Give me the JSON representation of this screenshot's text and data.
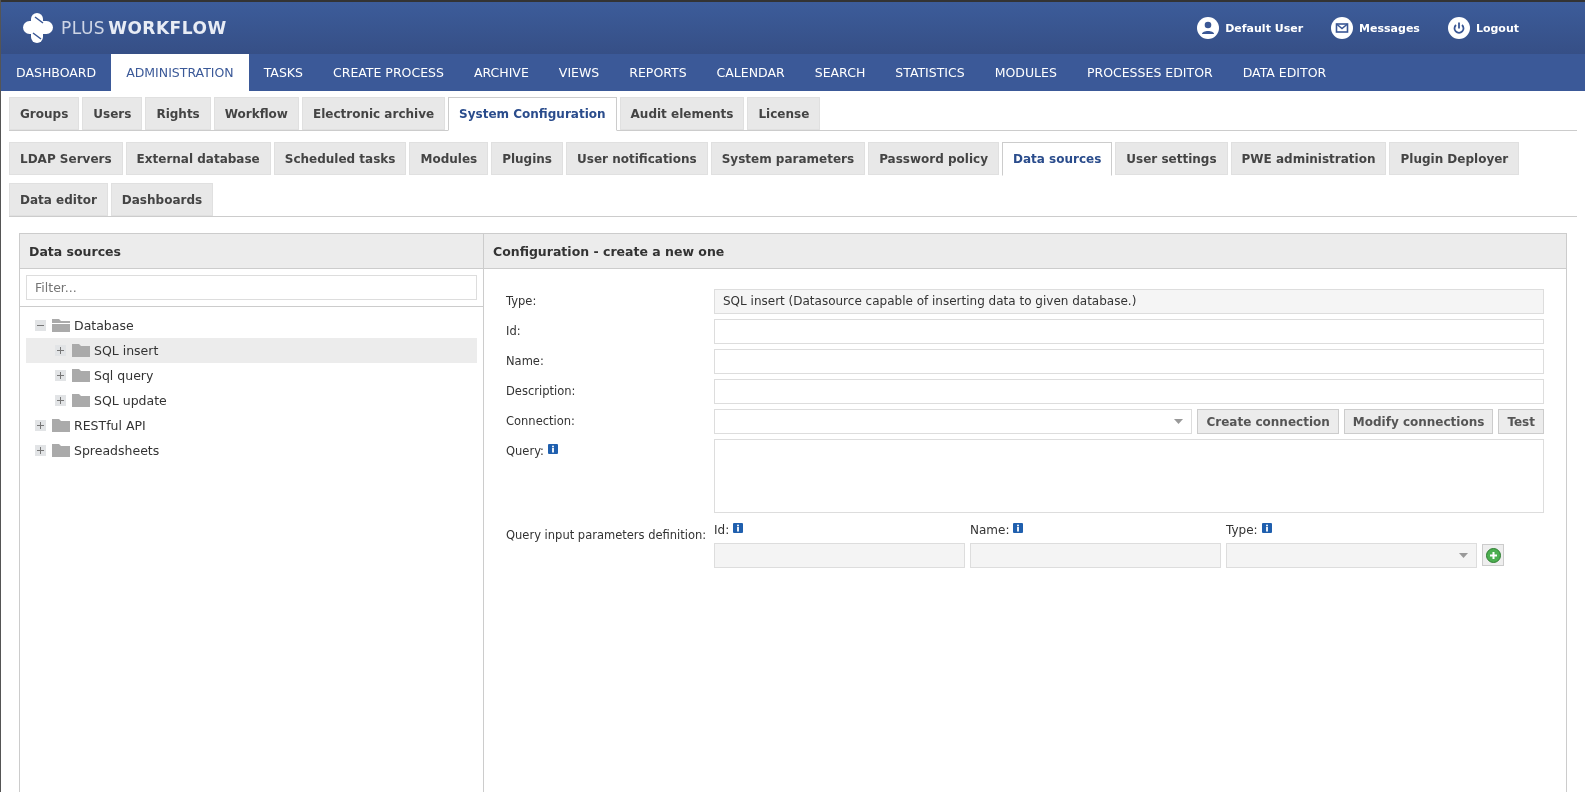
{
  "brand": {
    "plus": "PLUS",
    "workflow": "WORKFLOW"
  },
  "user_menu": [
    {
      "kind": "user",
      "label": "Default User"
    },
    {
      "kind": "mail",
      "label": "Messages"
    },
    {
      "kind": "power",
      "label": "Logout"
    }
  ],
  "main_nav": [
    {
      "label": "DASHBOARD",
      "selected": false
    },
    {
      "label": "ADMINISTRATION",
      "selected": true
    },
    {
      "label": "TASKS",
      "selected": false
    },
    {
      "label": "CREATE PROCESS",
      "selected": false
    },
    {
      "label": "ARCHIVE",
      "selected": false
    },
    {
      "label": "VIEWS",
      "selected": false
    },
    {
      "label": "REPORTS",
      "selected": false
    },
    {
      "label": "CALENDAR",
      "selected": false
    },
    {
      "label": "SEARCH",
      "selected": false
    },
    {
      "label": "STATISTICS",
      "selected": false
    },
    {
      "label": "MODULES",
      "selected": false
    },
    {
      "label": "PROCESSES EDITOR",
      "selected": false
    },
    {
      "label": "DATA EDITOR",
      "selected": false
    }
  ],
  "admin_tabs": [
    {
      "label": "Groups",
      "selected": false
    },
    {
      "label": "Users",
      "selected": false
    },
    {
      "label": "Rights",
      "selected": false
    },
    {
      "label": "Workflow",
      "selected": false
    },
    {
      "label": "Electronic archive",
      "selected": false
    },
    {
      "label": "System Configuration",
      "selected": true
    },
    {
      "label": "Audit elements",
      "selected": false
    },
    {
      "label": "License",
      "selected": false
    }
  ],
  "config_tabs": [
    {
      "label": "LDAP Servers",
      "selected": false
    },
    {
      "label": "External database",
      "selected": false
    },
    {
      "label": "Scheduled tasks",
      "selected": false
    },
    {
      "label": "Modules",
      "selected": false
    },
    {
      "label": "Plugins",
      "selected": false
    },
    {
      "label": "User notifications",
      "selected": false
    },
    {
      "label": "System parameters",
      "selected": false
    },
    {
      "label": "Password policy",
      "selected": false
    },
    {
      "label": "Data sources",
      "selected": true
    },
    {
      "label": "User settings",
      "selected": false
    },
    {
      "label": "PWE administration",
      "selected": false
    },
    {
      "label": "Plugin Deployer",
      "selected": false
    },
    {
      "label": "Data editor",
      "selected": false
    },
    {
      "label": "Dashboards",
      "selected": false
    }
  ],
  "left_panel": {
    "title": "Data sources",
    "filter": {
      "placeholder": "Filter..."
    },
    "tree": [
      {
        "label": "Database",
        "expanded": true,
        "selected": false,
        "children": [
          {
            "label": "SQL insert",
            "expanded": false,
            "selected": true
          },
          {
            "label": "Sql query",
            "expanded": false,
            "selected": false
          },
          {
            "label": "SQL update",
            "expanded": false,
            "selected": false
          }
        ]
      },
      {
        "label": "RESTful API",
        "expanded": false,
        "selected": false
      },
      {
        "label": "Spreadsheets",
        "expanded": false,
        "selected": false
      }
    ]
  },
  "right_panel": {
    "title": "Configuration - create a new one",
    "fields": [
      {
        "kind": "readonly",
        "label": "Type:",
        "value": "SQL insert (Datasource capable of inserting data to given database.)"
      },
      {
        "kind": "text",
        "label": "Id:"
      },
      {
        "kind": "text",
        "label": "Name:"
      },
      {
        "kind": "text",
        "label": "Description:"
      },
      {
        "kind": "select",
        "label": "Connection:",
        "buttons": [
          "Create connection",
          "Modify connections",
          "Test"
        ]
      },
      {
        "kind": "textarea",
        "label": "Query:"
      }
    ],
    "params": {
      "label": "Query input parameters definition:",
      "columns": [
        {
          "kind": "text",
          "label": "Id:"
        },
        {
          "kind": "text",
          "label": "Name:"
        },
        {
          "kind": "select",
          "label": "Type:"
        }
      ]
    }
  }
}
